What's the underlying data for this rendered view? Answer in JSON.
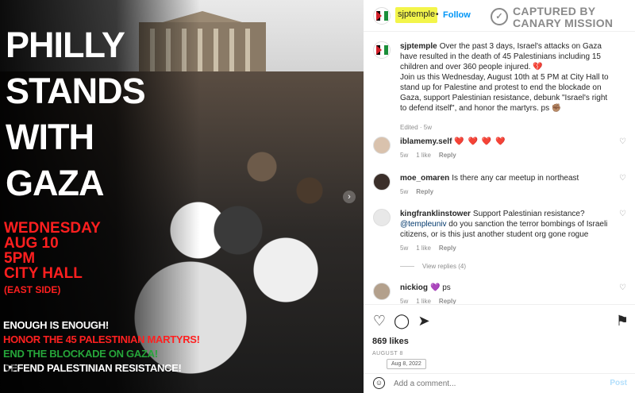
{
  "poster": {
    "headline": "PHILLY\nSTANDS\nWITH\nGAZA",
    "event": "WEDNESDAY\nAUG 10\n5PM\nCITY HALL",
    "event_sub": "(EAST SIDE)",
    "slogans": [
      "ENOUGH IS ENOUGH!",
      "HONOR THE 45 PALESTINIAN MARTYRS!",
      "END THE BLOCKADE ON GAZA!",
      "DEFEND PALESTINIAN RESISTANCE!"
    ],
    "colors": {
      "headline": "#ffffff",
      "event": "#ff1f1f",
      "slogan_green": "#26a63a"
    }
  },
  "header": {
    "username": "sjptemple",
    "separator": "•",
    "follow_label": "Follow",
    "watermark": "CAPTURED BY\nCANARY MISSION"
  },
  "caption": {
    "username": "sjptemple",
    "text": "Over the past 3 days, Israel's attacks on Gaza have resulted in the death of 45 Palestinians including 15 children and over 360 people injured. 💔\nJoin us this Wednesday, August 10th at 5 PM at City Hall to stand up for Palestine and protest to end the blockade on Gaza, support Palestinian resistance, debunk \"Israel's right to defend itself\", and honor the martyrs. ps ✊🏽",
    "meta": "Edited · 5w"
  },
  "comments": [
    {
      "username": "iblamemy.self",
      "text": "❤️ ❤️ ❤️ ❤️",
      "time": "5w",
      "likes": "1 like",
      "reply": "Reply"
    },
    {
      "username": "moe_omaren",
      "text": "Is there any car meetup in northeast",
      "time": "5w",
      "reply": "Reply"
    },
    {
      "username": "kingfranklinstower",
      "text": "Support Palestinian resistance? ",
      "mention": "@templeuniv",
      "text2": " do you sanction the terror bombings of Israeli citizens, or is this just another student org gone rogue",
      "time": "5w",
      "likes": "1 like",
      "reply": "Reply"
    },
    {
      "username": "nickiog",
      "text": "💜 ps",
      "time": "5w",
      "likes": "1 like",
      "reply": "Reply"
    }
  ],
  "view_replies": "View replies (4)",
  "likes": "869 likes",
  "date": "AUGUST 8",
  "date_tooltip": "Aug 8, 2022",
  "comment_box": {
    "placeholder": "Add a comment...",
    "post_label": "Post"
  }
}
